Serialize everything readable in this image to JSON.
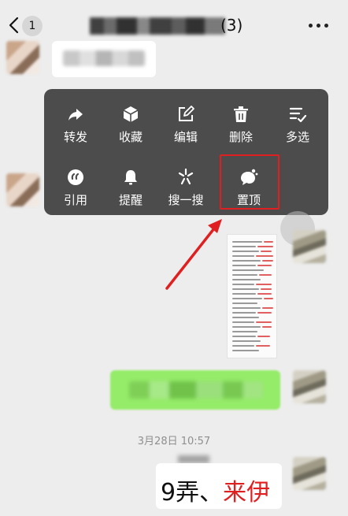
{
  "header": {
    "back_badge": "1",
    "title_count": "(3)",
    "more_icon": "more-dots-icon"
  },
  "context_menu": {
    "row1": [
      {
        "label": "转发",
        "icon": "forward-icon"
      },
      {
        "label": "收藏",
        "icon": "favorite-cube-icon"
      },
      {
        "label": "编辑",
        "icon": "edit-icon"
      },
      {
        "label": "删除",
        "icon": "trash-icon"
      },
      {
        "label": "多选",
        "icon": "multiselect-icon"
      }
    ],
    "row2": [
      {
        "label": "引用",
        "icon": "quote-icon"
      },
      {
        "label": "提醒",
        "icon": "bell-icon"
      },
      {
        "label": "搜一搜",
        "icon": "search-spark-icon"
      },
      {
        "label": "置顶",
        "icon": "pin-bubble-icon"
      }
    ]
  },
  "messages": {
    "timestamp": "3月28日 10:57",
    "last_text_part1": "9弄、",
    "last_text_part2": "来伊"
  },
  "colors": {
    "background": "#ededed",
    "menu_bg": "#4c4c4c",
    "highlight": "#e02020",
    "green_bubble": "#95ec69"
  }
}
